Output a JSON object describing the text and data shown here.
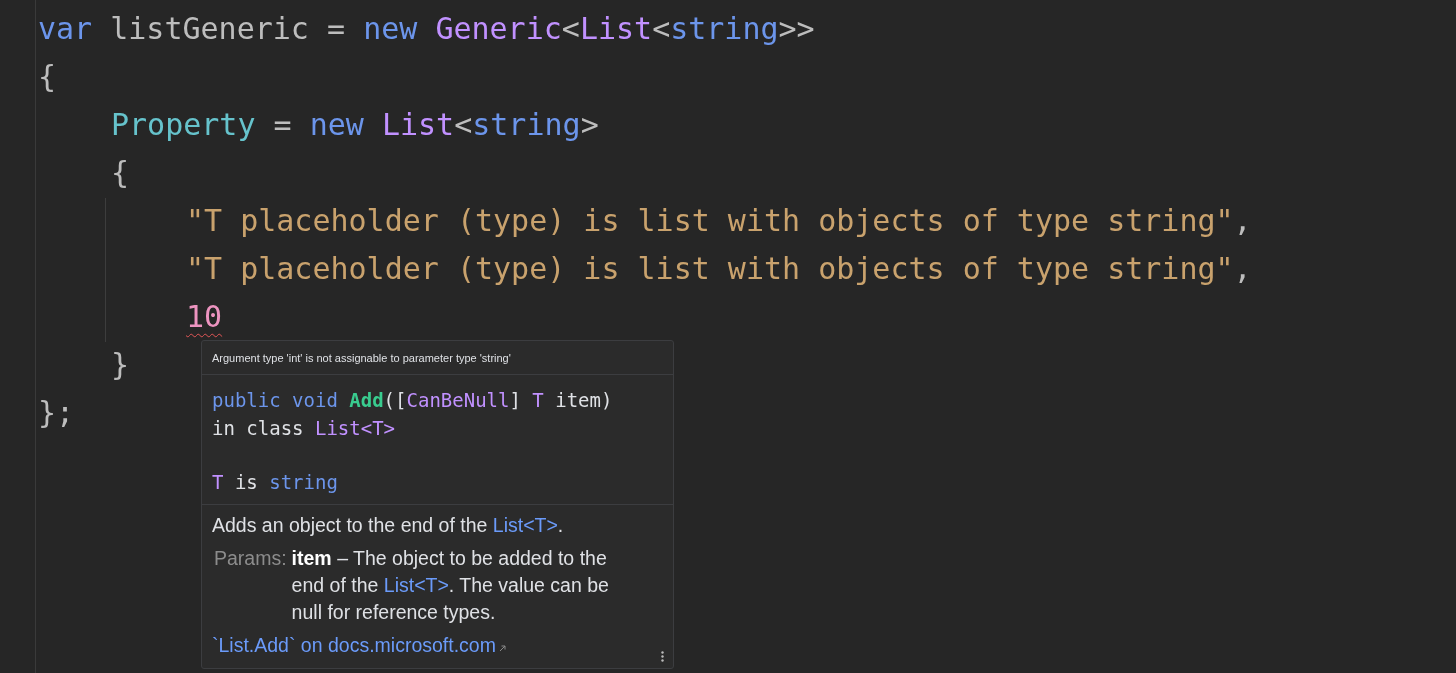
{
  "editor": {
    "lines": [
      {
        "tokens": [
          {
            "text": "var",
            "kind": "keyword"
          },
          {
            "text": " listGeneric = ",
            "kind": "plain"
          },
          {
            "text": "new ",
            "kind": "keyword"
          },
          {
            "text": "Generic",
            "kind": "type"
          },
          {
            "text": "<",
            "kind": "plain"
          },
          {
            "text": "List",
            "kind": "type"
          },
          {
            "text": "<",
            "kind": "plain"
          },
          {
            "text": "string",
            "kind": "keyword"
          },
          {
            "text": ">>",
            "kind": "plain"
          }
        ]
      },
      {
        "tokens": [
          {
            "text": "{",
            "kind": "plain"
          }
        ],
        "children": [
          {
            "tokens": [
              {
                "text": "Property",
                "kind": "property"
              },
              {
                "text": " = ",
                "kind": "plain"
              },
              {
                "text": "new ",
                "kind": "keyword"
              },
              {
                "text": "List",
                "kind": "type"
              },
              {
                "text": "<",
                "kind": "plain"
              },
              {
                "text": "string",
                "kind": "keyword"
              },
              {
                "text": ">",
                "kind": "plain"
              }
            ]
          },
          {
            "tokens": [
              {
                "text": "{",
                "kind": "plain"
              }
            ],
            "children": [
              {
                "tokens": [
                  {
                    "text": "\"T placeholder (type) is list with objects of type string\"",
                    "kind": "string"
                  },
                  {
                    "text": ",",
                    "kind": "plain"
                  }
                ]
              },
              {
                "tokens": [
                  {
                    "text": "\"T placeholder (type) is list with objects of type string\"",
                    "kind": "string"
                  },
                  {
                    "text": ",",
                    "kind": "plain"
                  }
                ]
              },
              {
                "tokens": [
                  {
                    "text": "10",
                    "kind": "number",
                    "error": true
                  }
                ]
              }
            ]
          },
          {
            "tokens": [
              {
                "text": "}",
                "kind": "plain"
              }
            ]
          }
        ]
      },
      {
        "tokens": [
          {
            "text": "};",
            "kind": "plain"
          }
        ]
      }
    ]
  },
  "tooltip": {
    "error_message": "Argument type 'int' is not assignable to parameter type 'string'",
    "declaration": [
      [
        {
          "text": "public void ",
          "kind": "keyword"
        },
        {
          "text": "Add",
          "kind": "method"
        },
        {
          "text": "([",
          "kind": "plain"
        },
        {
          "text": "CanBeNull",
          "kind": "type"
        },
        {
          "text": "] ",
          "kind": "plain"
        },
        {
          "text": "T",
          "kind": "type"
        },
        {
          "text": " item)",
          "kind": "plain"
        }
      ],
      [
        {
          "text": "in class ",
          "kind": "plain"
        },
        {
          "text": "List<T>",
          "kind": "type"
        }
      ]
    ],
    "binding": [
      {
        "text": "T",
        "kind": "type"
      },
      {
        "text": " is ",
        "kind": "plain"
      },
      {
        "text": "string",
        "kind": "keyword"
      }
    ],
    "description": [
      {
        "text": "Adds an object to the end of the ",
        "kind": "text"
      },
      {
        "text": "List<T>",
        "kind": "ref"
      },
      {
        "text": ".",
        "kind": "text"
      }
    ],
    "params_label": "Params:",
    "param_name": "item",
    "param_text": [
      {
        "text": " – The object to be added to the end of the ",
        "kind": "text"
      },
      {
        "text": "List<T>",
        "kind": "ref"
      },
      {
        "text": ". The value can be null for reference types.",
        "kind": "text"
      }
    ],
    "link": "`List.Add` on docs.microsoft.com"
  }
}
